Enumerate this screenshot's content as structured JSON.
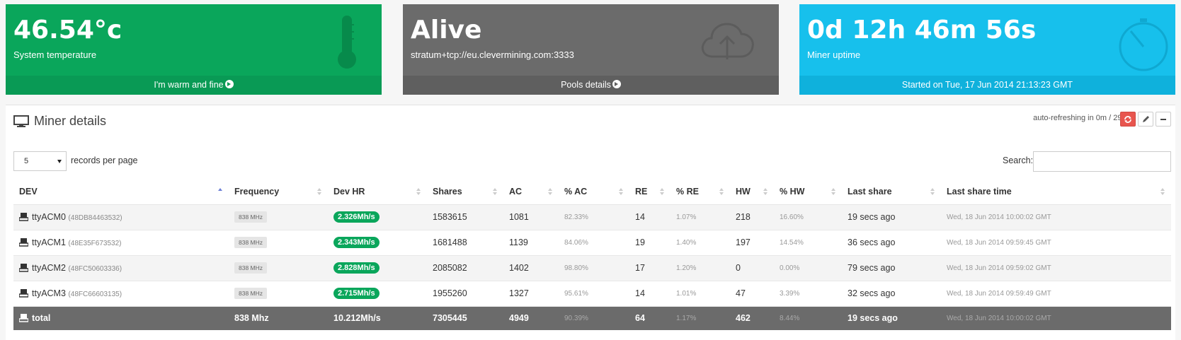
{
  "cards": {
    "temperature": {
      "value": "46.54°c",
      "label": "System temperature",
      "footer": "I'm warm and fine",
      "icon": "thermometer-icon",
      "color": "#0aa65b"
    },
    "pool": {
      "value": "Alive",
      "label": "stratum+tcp://eu.clevermining.com:3333",
      "footer": "Pools details",
      "icon": "cloud-upload-icon",
      "color": "#6b6b6b"
    },
    "uptime": {
      "value": "0d 12h 46m 56s",
      "label": "Miner uptime",
      "footer": "Started on Tue, 17 Jun 2014 21:13:23 GMT",
      "icon": "stopwatch-icon",
      "color": "#17c0ec"
    }
  },
  "panel": {
    "title": "Miner details",
    "refresh_text": "auto-refreshing in 0m / 29s",
    "records_select": "5",
    "records_label": "records per page",
    "search_label": "Search:",
    "search_value": ""
  },
  "table": {
    "headers": [
      "DEV",
      "Frequency",
      "Dev HR",
      "Shares",
      "AC",
      "% AC",
      "RE",
      "% RE",
      "HW",
      "% HW",
      "Last share",
      "Last share time"
    ],
    "rows": [
      {
        "dev": "ttyACM0",
        "serial": "(48DB84463532)",
        "freq": "838 MHz",
        "hr": "2.326Mh/s",
        "shares": "1583615",
        "ac": "1081",
        "pac": "82.33%",
        "re": "14",
        "pre": "1.07%",
        "hw": "218",
        "phw": "16.60%",
        "last": "19 secs ago",
        "time": "Wed, 18 Jun 2014 10:00:02 GMT"
      },
      {
        "dev": "ttyACM1",
        "serial": "(48E35F673532)",
        "freq": "838 MHz",
        "hr": "2.343Mh/s",
        "shares": "1681488",
        "ac": "1139",
        "pac": "84.06%",
        "re": "19",
        "pre": "1.40%",
        "hw": "197",
        "phw": "14.54%",
        "last": "36 secs ago",
        "time": "Wed, 18 Jun 2014 09:59:45 GMT"
      },
      {
        "dev": "ttyACM2",
        "serial": "(48FC50603336)",
        "freq": "838 MHz",
        "hr": "2.828Mh/s",
        "shares": "2085082",
        "ac": "1402",
        "pac": "98.80%",
        "re": "17",
        "pre": "1.20%",
        "hw": "0",
        "phw": "0.00%",
        "last": "79 secs ago",
        "time": "Wed, 18 Jun 2014 09:59:02 GMT"
      },
      {
        "dev": "ttyACM3",
        "serial": "(48FC66603135)",
        "freq": "838 MHz",
        "hr": "2.715Mh/s",
        "shares": "1955260",
        "ac": "1327",
        "pac": "95.61%",
        "re": "14",
        "pre": "1.01%",
        "hw": "47",
        "phw": "3.39%",
        "last": "32 secs ago",
        "time": "Wed, 18 Jun 2014 09:59:49 GMT"
      }
    ],
    "total": {
      "dev": "total",
      "freq": "838 Mhz",
      "hr": "10.212Mh/s",
      "shares": "7305445",
      "ac": "4949",
      "pac": "90.39%",
      "re": "64",
      "pre": "1.17%",
      "hw": "462",
      "phw": "8.44%",
      "last": "19 secs ago",
      "time": "Wed, 18 Jun 2014 10:00:02 GMT"
    }
  }
}
